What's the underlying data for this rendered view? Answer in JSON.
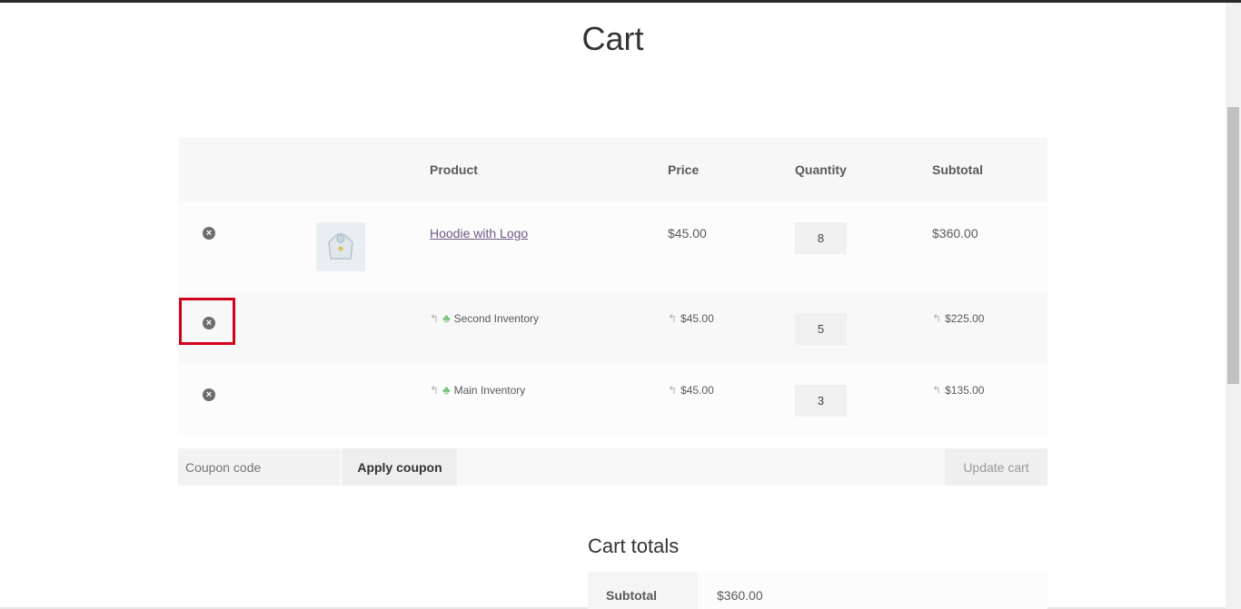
{
  "page": {
    "title": "Cart"
  },
  "table": {
    "headers": {
      "product": "Product",
      "price": "Price",
      "quantity": "Quantity",
      "subtotal": "Subtotal"
    },
    "main_item": {
      "name": "Hoodie with Logo",
      "price": "$45.00",
      "quantity": "8",
      "subtotal": "$360.00",
      "remove": "×"
    },
    "sub_items": [
      {
        "name": "Second Inventory",
        "price": "$45.00",
        "quantity": "5",
        "subtotal": "$225.00",
        "remove": "×"
      },
      {
        "name": "Main Inventory",
        "price": "$45.00",
        "quantity": "3",
        "subtotal": "$135.00",
        "remove": "×"
      }
    ]
  },
  "actions": {
    "coupon_placeholder": "Coupon code",
    "apply_label": "Apply coupon",
    "update_label": "Update cart"
  },
  "totals": {
    "title": "Cart totals",
    "subtotal_label": "Subtotal",
    "subtotal_value": "$360.00"
  },
  "icons": {
    "arrow": "↰",
    "inventory": "♣"
  },
  "colors": {
    "highlight": "#d0021b",
    "link": "#6d5a82",
    "inventory_icon": "#77c27a"
  }
}
